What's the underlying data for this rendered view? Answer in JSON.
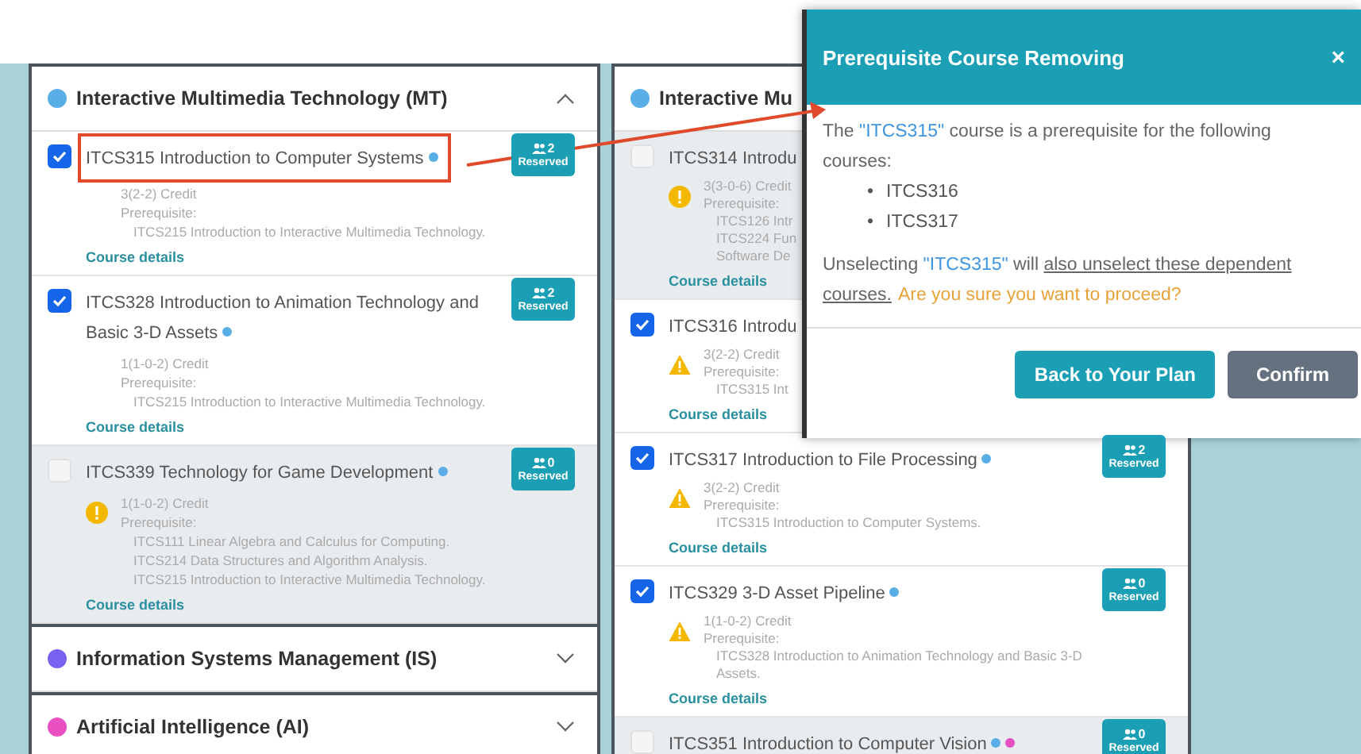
{
  "left_panel": {
    "groups": [
      {
        "name": "Interactive Multimedia Technology (MT)",
        "color": "#5aaee8",
        "expanded": true,
        "courses": [
          {
            "title": "ITCS315 Introduction to Computer Systems",
            "checked": true,
            "highlighted": true,
            "kind": "normal",
            "dots": [
              {
                "color": "#5aaee8"
              }
            ],
            "credit": "3(2-2) Credit",
            "prereq_label": "Prerequisite:",
            "prereqs": [
              "ITCS215 Introduction to Interactive Multimedia Technology."
            ],
            "details": "Course details",
            "reserved": {
              "count": "2",
              "label": "Reserved"
            }
          },
          {
            "title": "ITCS328 Introduction to Animation Technology and Basic 3-D Assets",
            "checked": true,
            "highlighted": false,
            "kind": "normal",
            "dots": [
              {
                "color": "#5aaee8"
              }
            ],
            "credit": "1(1-0-2) Credit",
            "prereq_label": "Prerequisite:",
            "prereqs": [
              "ITCS215 Introduction to Interactive Multimedia Technology."
            ],
            "details": "Course details",
            "reserved": {
              "count": "2",
              "label": "Reserved"
            }
          },
          {
            "title": "ITCS339 Technology for Game Development",
            "checked": false,
            "highlighted": false,
            "kind": "info",
            "dots": [
              {
                "color": "#5aaee8"
              }
            ],
            "credit": "1(1-0-2) Credit",
            "prereq_label": "Prerequisite:",
            "prereqs": [
              "ITCS111 Linear Algebra and Calculus for Computing.",
              "ITCS214 Data Structures and Algorithm Analysis.",
              "ITCS215 Introduction to Interactive Multimedia Technology."
            ],
            "details": "Course details",
            "reserved": {
              "count": "0",
              "label": "Reserved"
            }
          }
        ]
      },
      {
        "name": "Information Systems Management (IS)",
        "color": "#7b61f0",
        "expanded": false
      },
      {
        "name": "Artificial Intelligence (AI)",
        "color": "#e84fc0",
        "expanded": false
      }
    ]
  },
  "right_panel": {
    "groups": [
      {
        "name": "Interactive Mu",
        "color": "#5aaee8",
        "courses": [
          {
            "title": "ITCS314 Introdu",
            "checked": false,
            "highlighted": false,
            "kind": "info",
            "credit": "3(3-0-6) Credit",
            "prereq_label": "Prerequisite:",
            "prereqs": [
              "ITCS126 Intr",
              "ITCS224 Fun",
              "Software De"
            ],
            "details": "Course details"
          },
          {
            "title": "ITCS316 Introdu",
            "checked": true,
            "highlighted": false,
            "kind": "warning",
            "credit": "3(2-2) Credit",
            "prereq_label": "Prerequisite:",
            "prereqs": [
              "ITCS315 Int"
            ],
            "details": "Course details"
          },
          {
            "title": "ITCS317 Introduction to File Processing",
            "checked": true,
            "highlighted": false,
            "kind": "warning",
            "dots": [
              {
                "color": "#5aaee8"
              }
            ],
            "credit": "3(2-2) Credit",
            "prereq_label": "Prerequisite:",
            "prereqs": [
              "ITCS315 Introduction to Computer Systems."
            ],
            "details": "Course details",
            "reserved": {
              "count": "2",
              "label": "Reserved"
            }
          },
          {
            "title": "ITCS329 3-D Asset Pipeline",
            "checked": true,
            "highlighted": false,
            "kind": "warning",
            "dots": [
              {
                "color": "#5aaee8"
              }
            ],
            "credit": "1(1-0-2) Credit",
            "prereq_label": "Prerequisite:",
            "prereqs": [
              "ITCS328 Introduction to Animation Technology and Basic 3-D Assets."
            ],
            "details": "Course details",
            "reserved": {
              "count": "0",
              "label": "Reserved"
            }
          },
          {
            "title": "ITCS351 Introduction to Computer Vision",
            "checked": false,
            "highlighted": false,
            "dots": [
              {
                "color": "#5aaee8"
              },
              {
                "color": "#e84fc0"
              }
            ],
            "reserved": {
              "count": "0",
              "label": "Reserved"
            }
          }
        ]
      }
    ]
  },
  "dialog": {
    "title": "Prerequisite Course Removing",
    "close": "×",
    "message": [
      {
        "kind": "plain",
        "text": "The "
      },
      {
        "kind": "course",
        "text": "\"ITCS315\""
      },
      {
        "kind": "plain",
        "text": " course is a prerequisite for the following courses:"
      }
    ],
    "dependents": [
      {
        "bullet": "•",
        "text": "ITCS316"
      },
      {
        "bullet": "•",
        "text": "ITCS317"
      }
    ],
    "warning": [
      {
        "kind": "plain",
        "text": "Unselecting "
      },
      {
        "kind": "course",
        "text": "\"ITCS315\""
      },
      {
        "kind": "plain",
        "text": " will "
      },
      {
        "kind": "underline",
        "text": "also unselect these dependent courses."
      },
      {
        "kind": "caution",
        "text": "Are you sure you want to proceed?"
      }
    ],
    "buttons": [
      {
        "label": "Back to Your Plan",
        "kind": "primary"
      },
      {
        "label": "Confirm",
        "kind": "secondary"
      }
    ]
  }
}
